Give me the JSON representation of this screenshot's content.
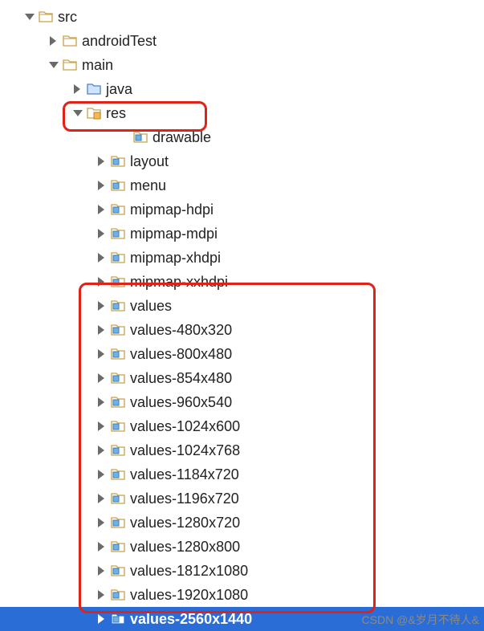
{
  "tree": {
    "src": {
      "label": "src",
      "indent": 30,
      "arrow": "down",
      "icon": "folder-open"
    },
    "androidTest": {
      "label": "androidTest",
      "indent": 60,
      "arrow": "right",
      "icon": "folder-open"
    },
    "main": {
      "label": "main",
      "indent": 60,
      "arrow": "down",
      "icon": "folder-open"
    },
    "java": {
      "label": "java",
      "indent": 90,
      "arrow": "right",
      "icon": "folder-blue"
    },
    "res": {
      "label": "res",
      "indent": 90,
      "arrow": "down",
      "icon": "folder-marked"
    },
    "drawable": {
      "label": "drawable",
      "indent": 148,
      "arrow": "none",
      "icon": "folder-res"
    },
    "layout": {
      "label": "layout",
      "indent": 120,
      "arrow": "right",
      "icon": "folder-res"
    },
    "menu": {
      "label": "menu",
      "indent": 120,
      "arrow": "right",
      "icon": "folder-res"
    },
    "mipmapH": {
      "label": "mipmap-hdpi",
      "indent": 120,
      "arrow": "right",
      "icon": "folder-res"
    },
    "mipmapM": {
      "label": "mipmap-mdpi",
      "indent": 120,
      "arrow": "right",
      "icon": "folder-res"
    },
    "mipmapX": {
      "label": "mipmap-xhdpi",
      "indent": 120,
      "arrow": "right",
      "icon": "folder-res"
    },
    "mipmapXX": {
      "label": "mipmap-xxhdpi",
      "indent": 120,
      "arrow": "right",
      "icon": "folder-res"
    },
    "values": {
      "label": "values",
      "indent": 120,
      "arrow": "right",
      "icon": "folder-res"
    },
    "values480": {
      "label": "values-480x320",
      "indent": 120,
      "arrow": "right",
      "icon": "folder-res"
    },
    "values800": {
      "label": "values-800x480",
      "indent": 120,
      "arrow": "right",
      "icon": "folder-res"
    },
    "values854": {
      "label": "values-854x480",
      "indent": 120,
      "arrow": "right",
      "icon": "folder-res"
    },
    "values960": {
      "label": "values-960x540",
      "indent": 120,
      "arrow": "right",
      "icon": "folder-res"
    },
    "values1024a": {
      "label": "values-1024x600",
      "indent": 120,
      "arrow": "right",
      "icon": "folder-res"
    },
    "values1024b": {
      "label": "values-1024x768",
      "indent": 120,
      "arrow": "right",
      "icon": "folder-res"
    },
    "values1184": {
      "label": "values-1184x720",
      "indent": 120,
      "arrow": "right",
      "icon": "folder-res"
    },
    "values1196": {
      "label": "values-1196x720",
      "indent": 120,
      "arrow": "right",
      "icon": "folder-res"
    },
    "values1280a": {
      "label": "values-1280x720",
      "indent": 120,
      "arrow": "right",
      "icon": "folder-res"
    },
    "values1280b": {
      "label": "values-1280x800",
      "indent": 120,
      "arrow": "right",
      "icon": "folder-res"
    },
    "values1812": {
      "label": "values-1812x1080",
      "indent": 120,
      "arrow": "right",
      "icon": "folder-res"
    },
    "values1920": {
      "label": "values-1920x1080",
      "indent": 120,
      "arrow": "right",
      "icon": "folder-res"
    },
    "values2560": {
      "label": "values-2560x1440",
      "indent": 120,
      "arrow": "rightW",
      "icon": "folder-resW",
      "selected": true
    }
  },
  "order": [
    "src",
    "androidTest",
    "main",
    "java",
    "res",
    "drawable",
    "layout",
    "menu",
    "mipmapH",
    "mipmapM",
    "mipmapX",
    "mipmapXX",
    "values",
    "values480",
    "values800",
    "values854",
    "values960",
    "values1024a",
    "values1024b",
    "values1184",
    "values1196",
    "values1280a",
    "values1280b",
    "values1812",
    "values1920",
    "values2560"
  ],
  "watermark": "CSDN @&岁月不待人&"
}
